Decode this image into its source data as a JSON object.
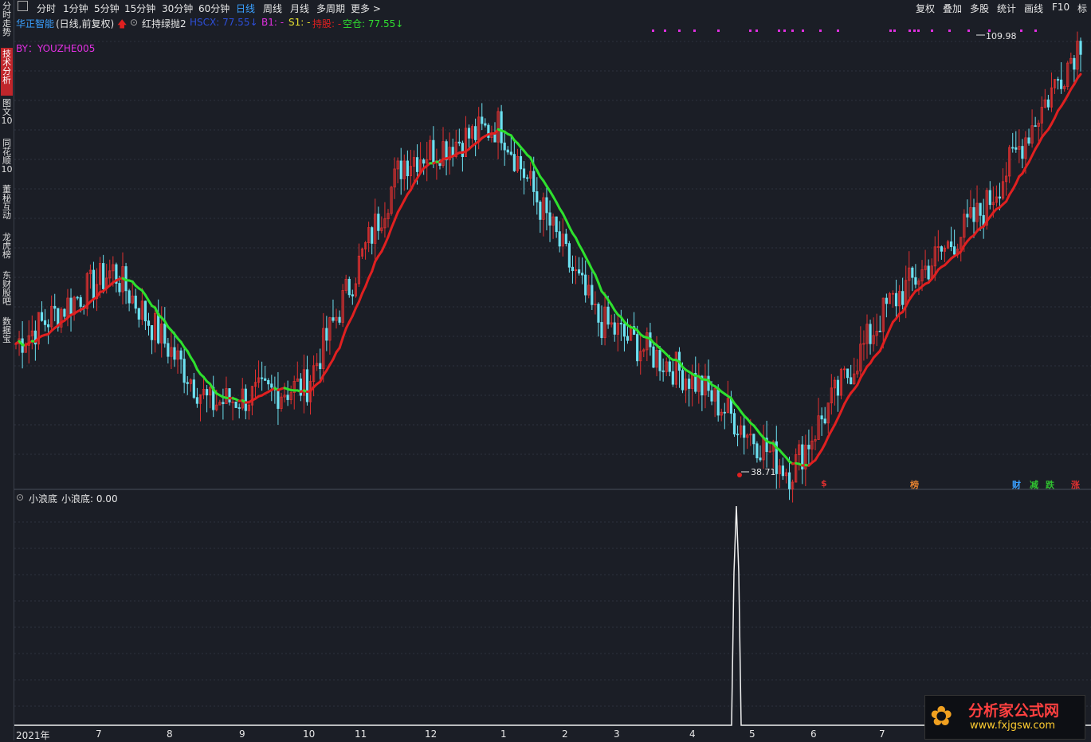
{
  "toolbar": {
    "icon": "panel-toggle-icon",
    "periods": [
      "分时",
      "1分钟",
      "5分钟",
      "15分钟",
      "30分钟",
      "60分钟",
      "日线",
      "周线",
      "月线",
      "多周期",
      "更多 >"
    ],
    "active_period": "日线",
    "right_buttons": [
      "复权",
      "叠加",
      "多股",
      "统计",
      "画线",
      "F10",
      "标"
    ]
  },
  "left_nav": [
    {
      "label": "分时走势",
      "active": false
    },
    {
      "label": "技术分析",
      "active": true
    },
    {
      "label": "图文10",
      "active": false
    },
    {
      "label": "同花顺10",
      "active": false
    },
    {
      "label": "董秘互动",
      "active": false
    },
    {
      "label": "龙虎榜",
      "active": false
    },
    {
      "label": "东财股吧",
      "active": false
    },
    {
      "label": "数据宝",
      "active": false
    }
  ],
  "main_legend": {
    "stock_name": "华正智能",
    "mode": "(日线,前复权)",
    "indicator_name": "红持绿抛2",
    "field1": "HSCX: 77.55↓",
    "field_b1": "B1: -",
    "field_s1": "S1: -",
    "field_hold": "持股: -",
    "field_empty": "空仓: 77.55↓",
    "author": "BY：YOUZHE005"
  },
  "price_annotations": {
    "high": "109.98",
    "low": "38.71"
  },
  "event_tags": [
    {
      "label": "$",
      "color": "#e03030"
    },
    {
      "label": "榜",
      "color": "#e08030"
    },
    {
      "label": "财",
      "color": "#3aa0ff"
    },
    {
      "label": "减",
      "color": "#30c030"
    },
    {
      "label": "跌",
      "color": "#30c030"
    },
    {
      "label": "涨",
      "color": "#e03030"
    }
  ],
  "sub_legend": {
    "name": "小浪底",
    "value": "小浪底: 0.00"
  },
  "x_axis": [
    "2021年",
    "7",
    "8",
    "9",
    "10",
    "11",
    "12",
    "1",
    "2",
    "3",
    "4",
    "5",
    "6",
    "7"
  ],
  "logo": {
    "text": "分析家公式网",
    "url": "www.fxjgsw.com"
  },
  "colors": {
    "up": "#e03030",
    "down": "#6ce0f0",
    "bull_line": "#e02020",
    "bear_line": "#2ee02e",
    "background": "#1b1e26",
    "grid": "#2e333d"
  },
  "chart_data": {
    "type": "candlestick",
    "price_range": [
      38.71,
      109.98
    ],
    "series": [
      {
        "name": "HSCX",
        "marker_colors": [
          "#e02020",
          "#2ee02e"
        ]
      }
    ],
    "anchors": [
      {
        "date": "2021-06",
        "price": 60
      },
      {
        "date": "2021-08",
        "price": 72
      },
      {
        "date": "2021-09",
        "price": 50
      },
      {
        "date": "2021-10",
        "price": 53
      },
      {
        "date": "2021-11",
        "price": 90
      },
      {
        "date": "2021-12",
        "price": 96
      },
      {
        "date": "2022-03",
        "price": 64
      },
      {
        "date": "2022-04",
        "price": 54
      },
      {
        "date": "2022-05",
        "price": 38.71
      },
      {
        "date": "2022-06",
        "price": 66
      },
      {
        "date": "2022-07",
        "price": 82
      },
      {
        "date": "2022-08",
        "price": 109.98
      }
    ],
    "sub_indicator": {
      "name": "小浪底",
      "spike_at": "2022-05",
      "last_value": 0.0
    }
  }
}
